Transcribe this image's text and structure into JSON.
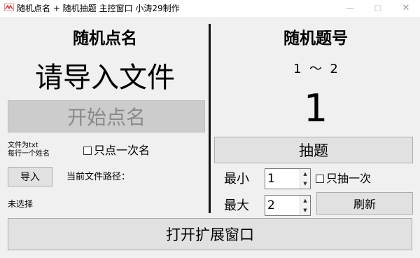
{
  "window": {
    "title": "随机点名 + 随机抽题  主控窗口  小涛29制作",
    "min_glyph": "—",
    "max_glyph": "☐",
    "close_glyph": "✕"
  },
  "left": {
    "heading": "随机点名",
    "file_prompt": "请导入文件",
    "start_button": "开始点名",
    "hint_line1": "文件为txt",
    "hint_line2": "每行一个姓名",
    "once_checkbox": "只点一次名",
    "import_button": "导入",
    "path_label": "当前文件路径：",
    "path_value": "未选择"
  },
  "right": {
    "heading": "随机题号",
    "range_text": "1  ～  2",
    "result": "1",
    "draw_button": "抽题",
    "min_label": "最小",
    "min_value": "1",
    "max_label": "最大",
    "max_value": "2",
    "once_checkbox": "只抽一次",
    "refresh_button": "刷新"
  },
  "bottom": {
    "extend_button": "打开扩展窗口"
  }
}
